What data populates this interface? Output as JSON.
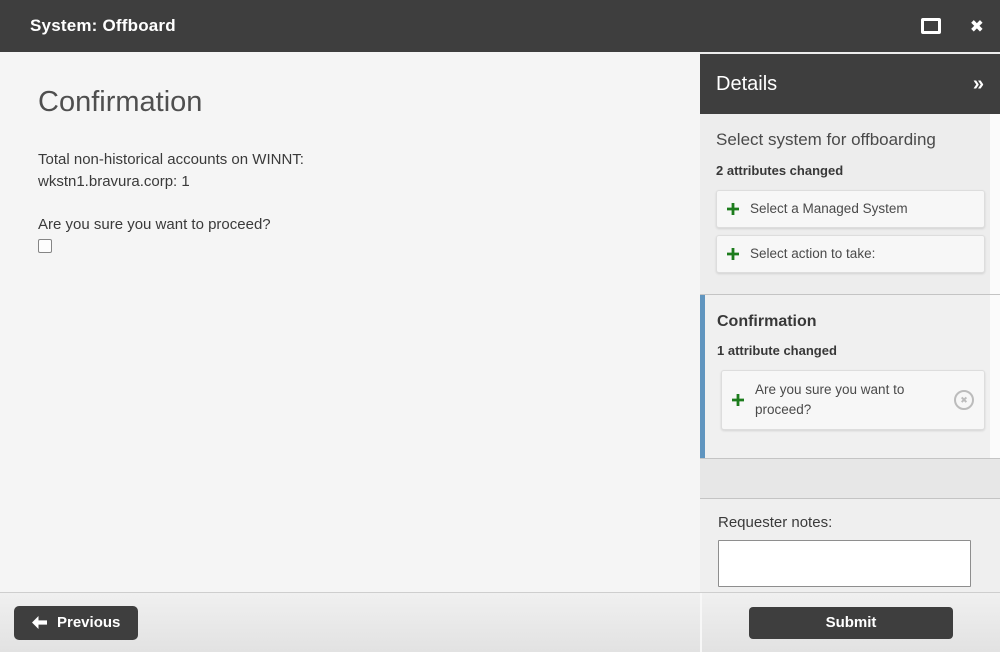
{
  "window": {
    "title": "System: Offboard",
    "icons": {
      "maximize": "maximize-icon",
      "close_glyph": "✖"
    }
  },
  "main": {
    "heading": "Confirmation",
    "summary_line1": "Total non-historical accounts on WINNT:",
    "summary_line2": "wkstn1.bravura.corp: 1",
    "confirm_question": "Are you sure you want to proceed?",
    "checkbox_checked": false
  },
  "sidebar": {
    "header": {
      "title": "Details",
      "collapse_glyph": "»"
    },
    "sections": [
      {
        "title": "Select system for offboarding",
        "status": "2 attributes changed",
        "items": [
          {
            "label": "Select a Managed System"
          },
          {
            "label": "Select action to take:"
          }
        ]
      },
      {
        "title": "Confirmation",
        "status": "1 attribute changed",
        "items": [
          {
            "label": "Are you sure you want to proceed?",
            "removable": true
          }
        ]
      }
    ],
    "requester_notes": {
      "label": "Requester notes:",
      "value": ""
    }
  },
  "footer": {
    "previous_label": "Previous",
    "submit_label": "Submit"
  },
  "colors": {
    "titlebar": "#3e3e3e",
    "accent_green": "#1c7c1c",
    "accent_blue": "#6095bf",
    "button_dark": "#3e3e3e"
  }
}
